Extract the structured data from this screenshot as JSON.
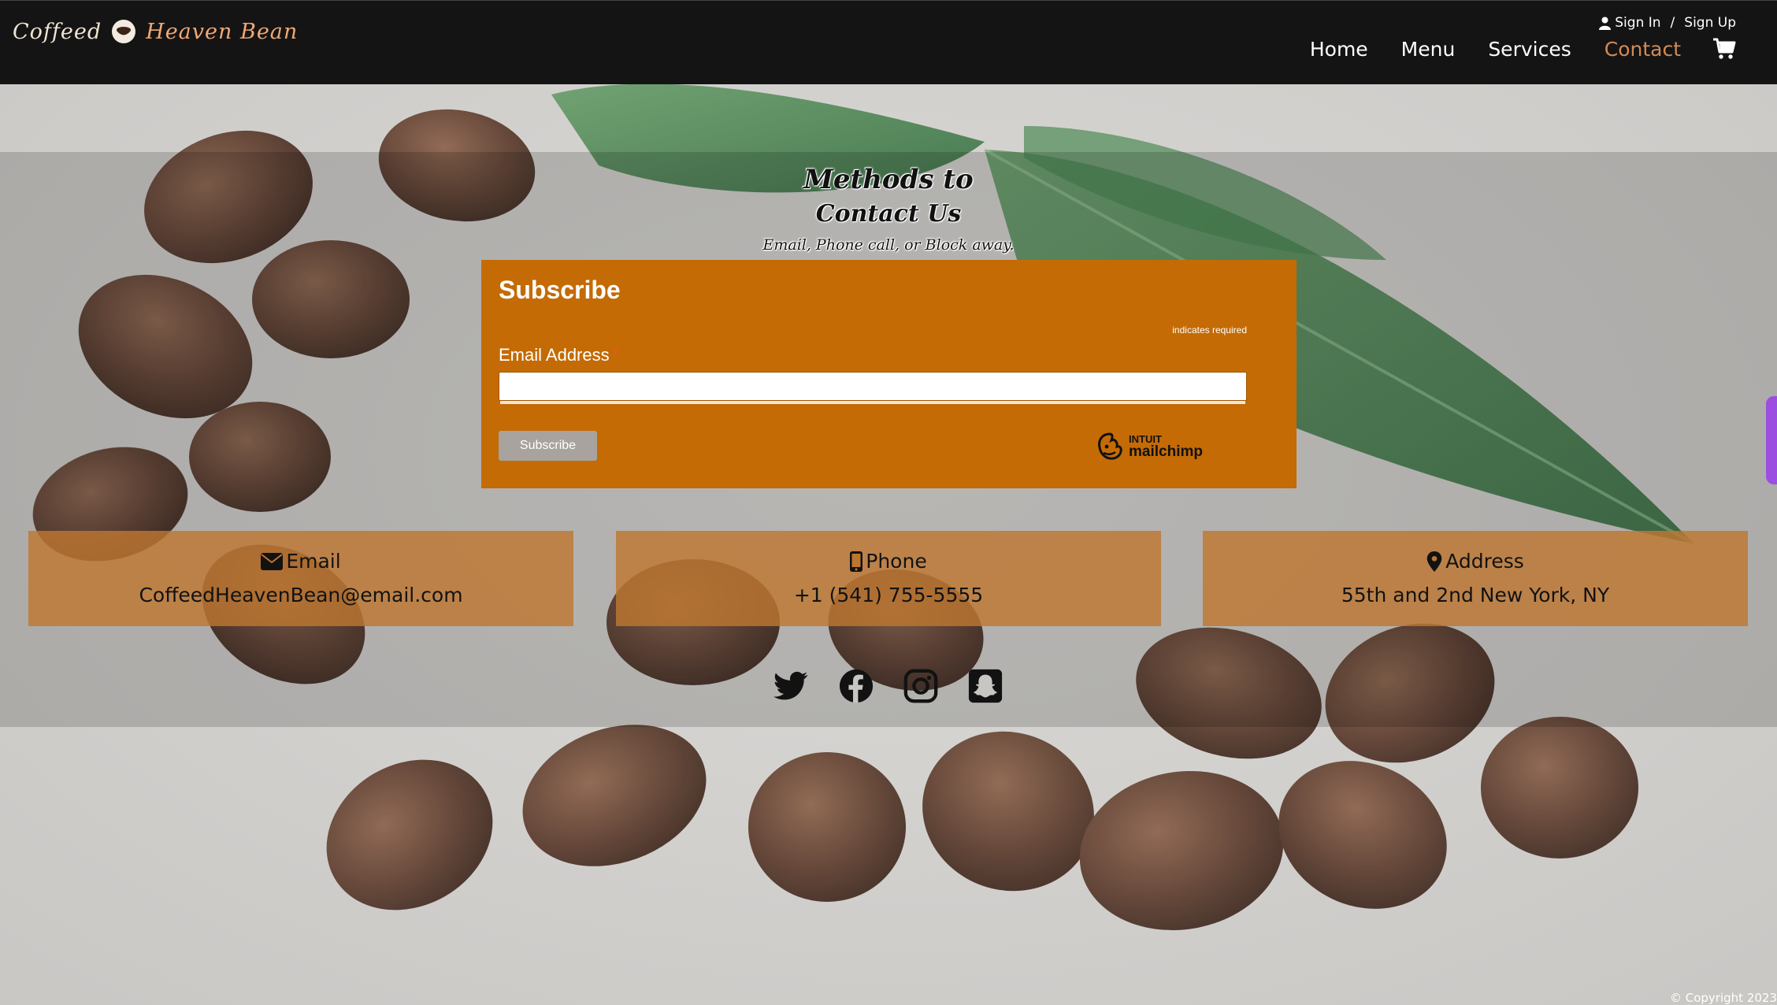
{
  "header": {
    "brand_part1": "Coffeed",
    "brand_part2": "Heaven Bean",
    "sign_in": "Sign In",
    "separator": "/",
    "sign_up": "Sign Up",
    "nav": [
      "Home",
      "Menu",
      "Services",
      "Contact"
    ],
    "active_nav": "Contact"
  },
  "hero": {
    "title_line1": "Methods to",
    "title_line2": "Contact Us",
    "subtitle": "Email, Phone call, or Block away."
  },
  "form": {
    "title": "Subscribe",
    "required_note": "indicates required",
    "required_marker": "*",
    "email_label": "Email Address",
    "email_value": "",
    "submit_label": "Subscribe",
    "badge_line1": "INTUIT",
    "badge_line2": "mailchimp"
  },
  "contact": {
    "email": {
      "label": "Email",
      "value": "CoffeedHeavenBean@email.com"
    },
    "phone": {
      "label": "Phone",
      "value": "+1 (541) 755-5555"
    },
    "address": {
      "label": "Address",
      "value": "55th and 2nd New York, NY"
    }
  },
  "social": [
    "twitter-icon",
    "facebook-icon",
    "instagram-icon",
    "snapchat-icon"
  ],
  "footer": {
    "copyright": "© Copyright 2023"
  },
  "colors": {
    "header_bg": "#141414",
    "accent": "#d38a55",
    "form_bg": "#c46b05",
    "card_bg": "#bd7631"
  }
}
